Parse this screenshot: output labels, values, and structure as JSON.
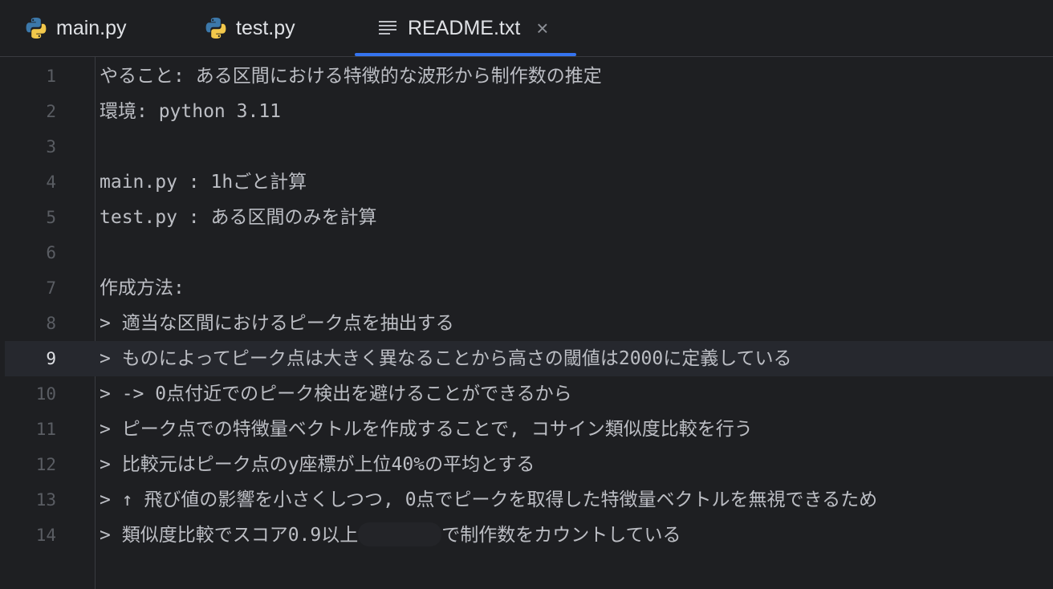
{
  "tabs": [
    {
      "label": "main.py",
      "icon": "python-icon",
      "active": false
    },
    {
      "label": "test.py",
      "icon": "python-icon",
      "active": false
    },
    {
      "label": "README.txt",
      "icon": "text-file-icon",
      "active": true,
      "close_glyph": "×"
    }
  ],
  "editor": {
    "current_line": 9,
    "lines": [
      {
        "n": "1",
        "text": "やること: ある区間における特徴的な波形から制作数の推定"
      },
      {
        "n": "2",
        "text": "環境: python 3.11"
      },
      {
        "n": "3",
        "text": ""
      },
      {
        "n": "4",
        "text": "main.py : 1hごと計算"
      },
      {
        "n": "5",
        "text": "test.py : ある区間のみを計算"
      },
      {
        "n": "6",
        "text": ""
      },
      {
        "n": "7",
        "text": "作成方法:"
      },
      {
        "n": "8",
        "text": "> 適当な区間におけるピーク点を抽出する"
      },
      {
        "n": "9",
        "text": "> ものによってピーク点は大きく異なることから高さの閾値は2000に定義している"
      },
      {
        "n": "10",
        "text": "> -> 0点付近でのピーク検出を避けることができるから"
      },
      {
        "n": "11",
        "text": "> ピーク点での特徴量ベクトルを作成することで, コサイン類似度比較を行う"
      },
      {
        "n": "12",
        "text": "> 比較元はピーク点のy座標が上位40%の平均とする"
      },
      {
        "n": "13",
        "text": "> ↑ 飛び値の影響を小さくしつつ, 0点でピークを取得した特徴量ベクトルを無視できるため"
      },
      {
        "n": "14",
        "text_before": "> 類似度比較でスコア0.9以上",
        "text_after": "で制作数をカウントしている"
      }
    ]
  },
  "colors": {
    "background": "#1e1f22",
    "current_line": "#26282e",
    "accent": "#3574f0",
    "text": "#bcbec4",
    "line_number": "#5a5d63"
  }
}
